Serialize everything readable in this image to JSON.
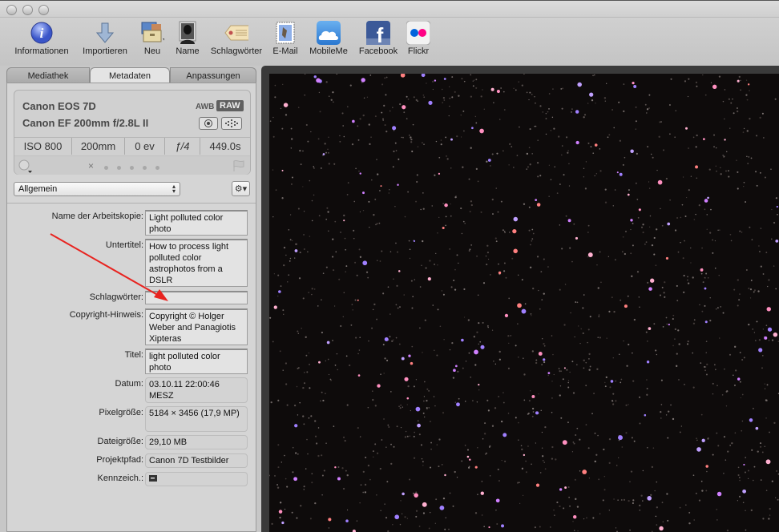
{
  "window": {
    "traffic_lights": [
      "close",
      "minimize",
      "zoom"
    ]
  },
  "toolbar": {
    "items": [
      {
        "label": "Informationen",
        "icon": "info-icon"
      },
      {
        "label": "Importieren",
        "icon": "import-arrow-icon"
      },
      {
        "label": "Neu",
        "icon": "new-project-box-icon"
      },
      {
        "label": "Name",
        "icon": "person-silhouette-icon"
      },
      {
        "label": "Schlagwörter",
        "icon": "tag-icon"
      },
      {
        "label": "E-Mail",
        "icon": "mail-stamp-icon"
      },
      {
        "label": "MobileMe",
        "icon": "cloud-icon"
      },
      {
        "label": "Facebook",
        "icon": "facebook-icon"
      },
      {
        "label": "Flickr",
        "icon": "flickr-icon"
      }
    ]
  },
  "inspector": {
    "tabs": [
      {
        "label": "Mediathek",
        "active": false
      },
      {
        "label": "Metadaten",
        "active": true
      },
      {
        "label": "Anpassungen",
        "active": false
      }
    ],
    "camera": {
      "model": "Canon EOS 7D",
      "lens": "Canon EF 200mm f/2.8L II",
      "white_balance": "AWB",
      "format_badge": "RAW",
      "stats": [
        "ISO 800",
        "200mm",
        "0 ev",
        "ƒ/4",
        "449.0s"
      ],
      "rating_clear": "×",
      "rating_stars": 0,
      "rating_max": 5
    },
    "preset": {
      "selected": "Allgemein"
    },
    "fields": [
      {
        "label": "Name der Arbeitskopie:",
        "value": "Light polluted color photo",
        "editable": true
      },
      {
        "label": "Untertitel:",
        "value": "How to process light polluted color astrophotos from a DSLR",
        "editable": true
      },
      {
        "label": "Schlagwörter:",
        "value": "",
        "editable": true
      },
      {
        "label": "Copyright-Hinweis:",
        "value": "Copyright © Holger Weber and Panagiotis Xipteras",
        "editable": true
      },
      {
        "label": "Titel:",
        "value": "light polluted color photo",
        "editable": true
      },
      {
        "label": "Datum:",
        "value": "03.10.11 22:00:46 MESZ",
        "editable": false
      },
      {
        "label": "Pixelgröße:",
        "value": "5184 × 3456 (17,9 MP)",
        "editable": false
      },
      {
        "label": "Dateigröße:",
        "value": "29,10 MB",
        "editable": false
      },
      {
        "label": "Projektpfad:",
        "value": "Canon 7D Testbilder",
        "editable": false
      },
      {
        "label": "Kennzeich.:",
        "value": "",
        "editable": false
      }
    ]
  },
  "viewer": {
    "image_description": "star field, light polluted astrophoto",
    "annotation_color": "#e8231f"
  }
}
